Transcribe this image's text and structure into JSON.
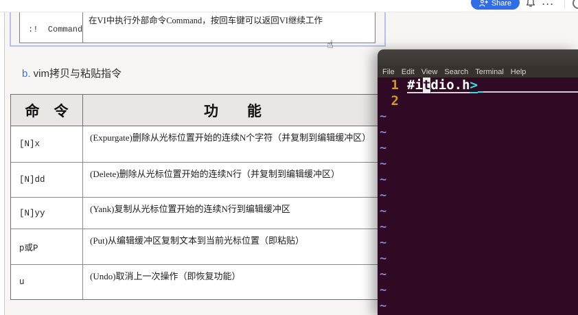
{
  "topbar": {
    "share_label": "Share",
    "ellipsis": "···"
  },
  "document": {
    "prev_table": {
      "command": ":!  Command",
      "function": "在VI中执行外部命令Command，按回车键可以返回VI继续工作"
    },
    "heading": {
      "marker": "b.",
      "title": " vim拷贝与粘贴指令"
    },
    "table": {
      "header": {
        "command": "命　令",
        "function": "功　　能"
      },
      "rows": [
        {
          "command": "[N]x",
          "function": "(Expurgate)删除从光标位置开始的连续N个字符（并复制到编辑缓冲区）"
        },
        {
          "command": "[N]dd",
          "function": "(Delete)删除从光标位置开始的连续N行（并复制到编辑缓冲区）"
        },
        {
          "command": "[N]yy",
          "function": "(Yank)复制从光标位置开始的连续N行到编辑缓冲区"
        },
        {
          "command": "p或P",
          "function": "(Put)从编辑缓冲区复制文本到当前光标位置（即粘贴）"
        },
        {
          "command": "u",
          "function": "(Undo)取消上一次操作（即恢复功能）"
        }
      ]
    },
    "hand_cursor": "☝"
  },
  "terminal": {
    "menu": [
      "File",
      "Edit",
      "View",
      "Search",
      "Terminal",
      "Help"
    ],
    "editor": {
      "line1": {
        "number": "1",
        "pre": "#i",
        "cursor": "t",
        "mid": "dio.h",
        "suffix": ">"
      },
      "line2": {
        "number": "2"
      },
      "tilde": "~"
    },
    "colors": {
      "terminal_background": "#300a24",
      "line_number": "#ce9a2e",
      "text": "#ffffff",
      "bracket": "#34e2e2",
      "tilde": "#8585d6",
      "share_accent": "#2f6ee4",
      "selection_border": "#b6c0ea"
    }
  }
}
